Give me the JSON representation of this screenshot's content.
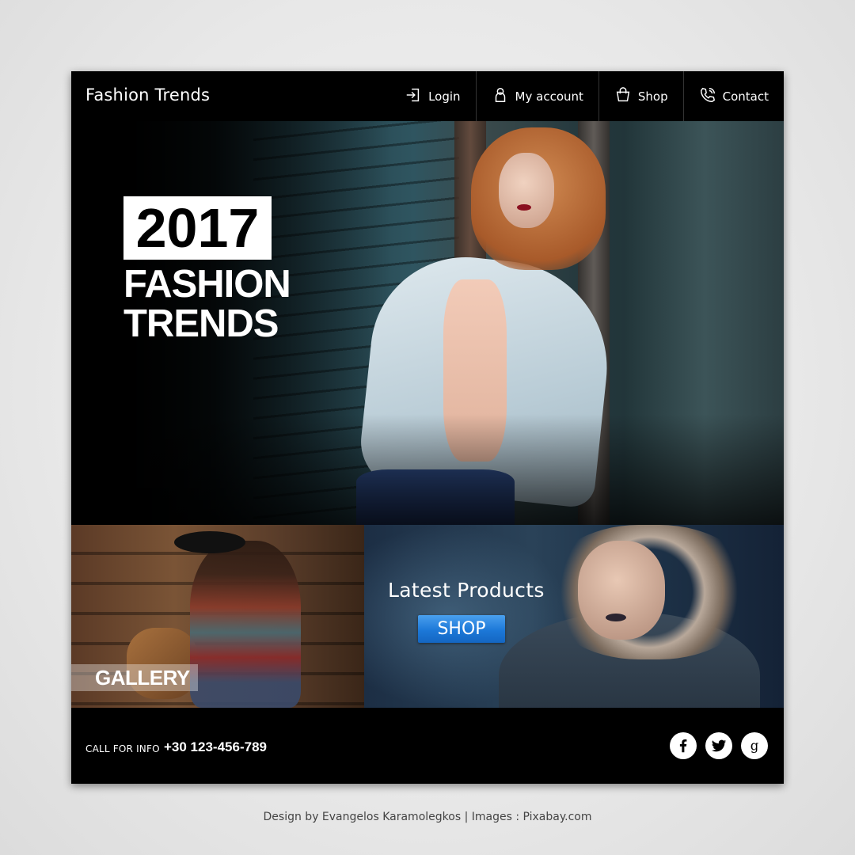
{
  "header": {
    "logo": "Fashion Trends",
    "nav": [
      {
        "label": "Login",
        "icon": "login-icon"
      },
      {
        "label": "My account",
        "icon": "user-icon"
      },
      {
        "label": "Shop",
        "icon": "shopping-bag-icon"
      },
      {
        "label": "Contact",
        "icon": "phone-icon"
      }
    ]
  },
  "hero": {
    "year": "2017",
    "line1": "FASHION",
    "line2": "TRENDS"
  },
  "gallery": {
    "label": "GALLERY"
  },
  "latest": {
    "title": "Latest Products",
    "button": "SHOP",
    "button_color": "#1c78d8"
  },
  "footer": {
    "call_label": "CALL FOR INFO",
    "phone": "+30 123-456-789",
    "social": [
      "facebook-icon",
      "twitter-icon",
      "google-icon"
    ]
  },
  "credit": "Design by Evangelos Karamolegkos | Images : Pixabay.com"
}
